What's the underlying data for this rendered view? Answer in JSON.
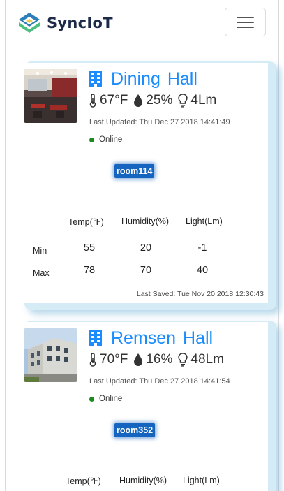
{
  "app": {
    "brand": "SyncIoT",
    "colors": {
      "brand_dark": "#1c2b4a",
      "accent": "#1a8cff",
      "badge": "#1565c0",
      "online": "#1f8a1f"
    }
  },
  "icons": {
    "menu": "hamburger-icon",
    "building": "building-icon",
    "temperature": "thermometer-icon",
    "humidity": "droplet-icon",
    "light": "lightbulb-icon"
  },
  "table_headers": {
    "temp": "Temp(℉)",
    "humidity": "Humidity(%)",
    "light": "Light(Lm)"
  },
  "row_labels": {
    "min": "Min",
    "max": "Max"
  },
  "rooms": [
    {
      "name": "Dining  Hall",
      "temp": "67°F",
      "humidity": "25%",
      "light": "4Lm",
      "last_updated": "Last Updated: Thu Dec 27 2018 14:41:49",
      "status": "Online",
      "room_id": "room114",
      "min": {
        "temp": "55",
        "humidity": "20",
        "light": "-1"
      },
      "max": {
        "temp": "78",
        "humidity": "70",
        "light": "40"
      },
      "last_saved": "Last Saved: Tue Nov 20 2018 12:30:43"
    },
    {
      "name": "Remsen  Hall",
      "temp": "70°F",
      "humidity": "16%",
      "light": "48Lm",
      "last_updated": "Last Updated: Thu Dec 27 2018 14:41:54",
      "status": "Online",
      "room_id": "room352"
    }
  ]
}
